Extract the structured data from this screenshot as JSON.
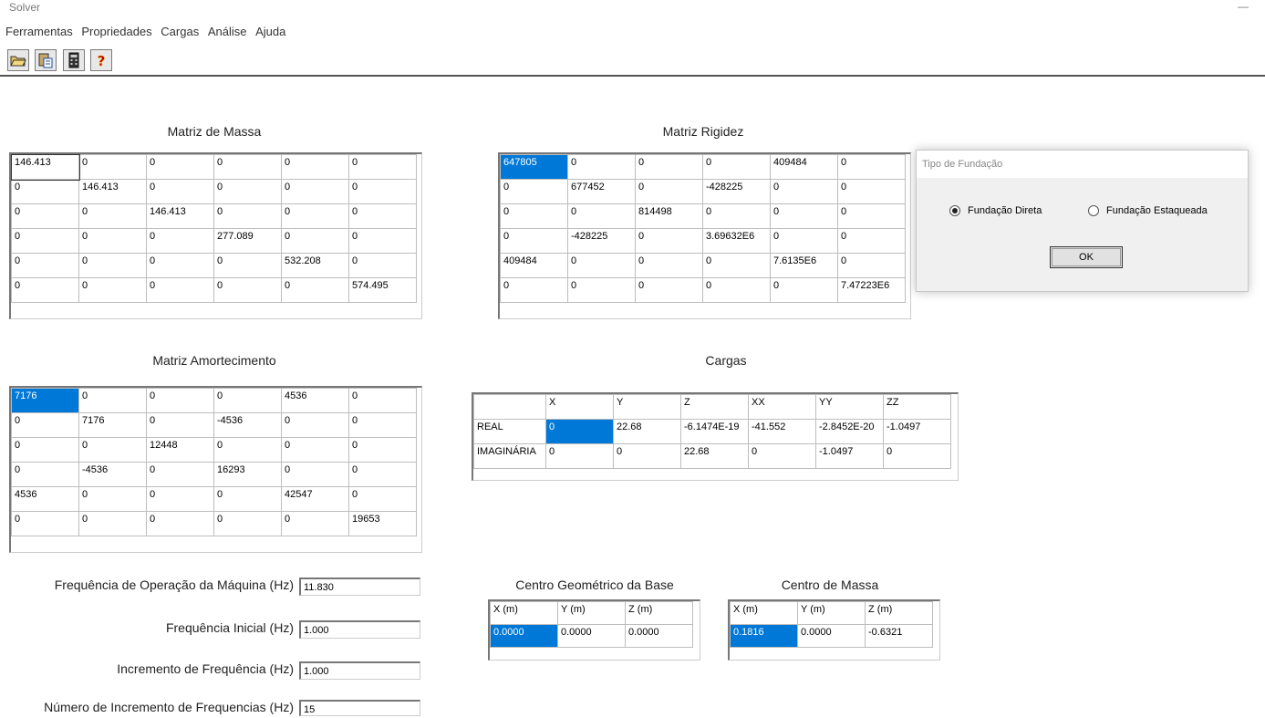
{
  "window": {
    "title": "Solver",
    "minimize": "—"
  },
  "menu": [
    "Ferramentas",
    "Propriedades",
    "Cargas",
    "Análise",
    "Ajuda"
  ],
  "toolbar": {
    "help_glyph": "?",
    "icons": [
      "open-folder-icon",
      "paste-icon",
      "calculator-icon",
      "help-icon"
    ]
  },
  "massa": {
    "title": "Matriz de Massa",
    "rows": [
      [
        "146.413",
        "0",
        "0",
        "0",
        "0",
        "0"
      ],
      [
        "0",
        "146.413",
        "0",
        "0",
        "0",
        "0"
      ],
      [
        "0",
        "0",
        "146.413",
        "0",
        "0",
        "0"
      ],
      [
        "0",
        "0",
        "0",
        "277.089",
        "0",
        "0"
      ],
      [
        "0",
        "0",
        "0",
        "0",
        "532.208",
        "0"
      ],
      [
        "0",
        "0",
        "0",
        "0",
        "0",
        "574.495"
      ]
    ]
  },
  "rigidez": {
    "title": "Matriz Rigidez",
    "rows": [
      [
        "647805",
        "0",
        "0",
        "0",
        "409484",
        "0"
      ],
      [
        "0",
        "677452",
        "0",
        "-428225",
        "0",
        "0"
      ],
      [
        "0",
        "0",
        "814498",
        "0",
        "0",
        "0"
      ],
      [
        "0",
        "-428225",
        "0",
        "3.69632E6",
        "0",
        "0"
      ],
      [
        "409484",
        "0",
        "0",
        "0",
        "7.6135E6",
        "0"
      ],
      [
        "0",
        "0",
        "0",
        "0",
        "0",
        "7.47223E6"
      ]
    ]
  },
  "amortecimento": {
    "title": "Matriz Amortecimento",
    "rows": [
      [
        "7176",
        "0",
        "0",
        "0",
        "4536",
        "0"
      ],
      [
        "0",
        "7176",
        "0",
        "-4536",
        "0",
        "0"
      ],
      [
        "0",
        "0",
        "12448",
        "0",
        "0",
        "0"
      ],
      [
        "0",
        "-4536",
        "0",
        "16293",
        "0",
        "0"
      ],
      [
        "4536",
        "0",
        "0",
        "0",
        "42547",
        "0"
      ],
      [
        "0",
        "0",
        "0",
        "0",
        "0",
        "19653"
      ]
    ]
  },
  "cargas": {
    "title": "Cargas",
    "headers": [
      "",
      "X",
      "Y",
      "Z",
      "XX",
      "YY",
      "ZZ"
    ],
    "rows": [
      [
        "REAL",
        "0",
        "22.68",
        "-6.1474E-19",
        "-41.552",
        "-2.8452E-20",
        "-1.0497"
      ],
      [
        "IMAGINÁRIA",
        "0",
        "0",
        "22.68",
        "0",
        "-1.0497",
        "0"
      ]
    ]
  },
  "centro_geom": {
    "title": "Centro Geométrico da Base",
    "headers": [
      "X (m)",
      "Y (m)",
      "Z (m)"
    ],
    "values": [
      "0.0000",
      "0.0000",
      "0.0000"
    ]
  },
  "centro_massa": {
    "title": "Centro de Massa",
    "headers": [
      "X (m)",
      "Y (m)",
      "Z (m)"
    ],
    "values": [
      "0.1816",
      "0.0000",
      "-0.6321"
    ]
  },
  "fields": [
    {
      "label": "Frequência de Operação da Máquina (Hz)",
      "value": "11.830"
    },
    {
      "label": "Frequência Inicial (Hz)",
      "value": "1.000"
    },
    {
      "label": "Incremento de Frequência (Hz)",
      "value": "1.000"
    },
    {
      "label": "Número de Incremento de Frequencias (Hz)",
      "value": "15"
    }
  ],
  "dialog": {
    "title": "Tipo de Fundação",
    "option1": "Fundação Direta",
    "option2": "Fundação Estaqueada",
    "selected": "option1",
    "ok": "OK"
  },
  "colors": {
    "selection": "#0078d7",
    "separator": "#555555"
  }
}
